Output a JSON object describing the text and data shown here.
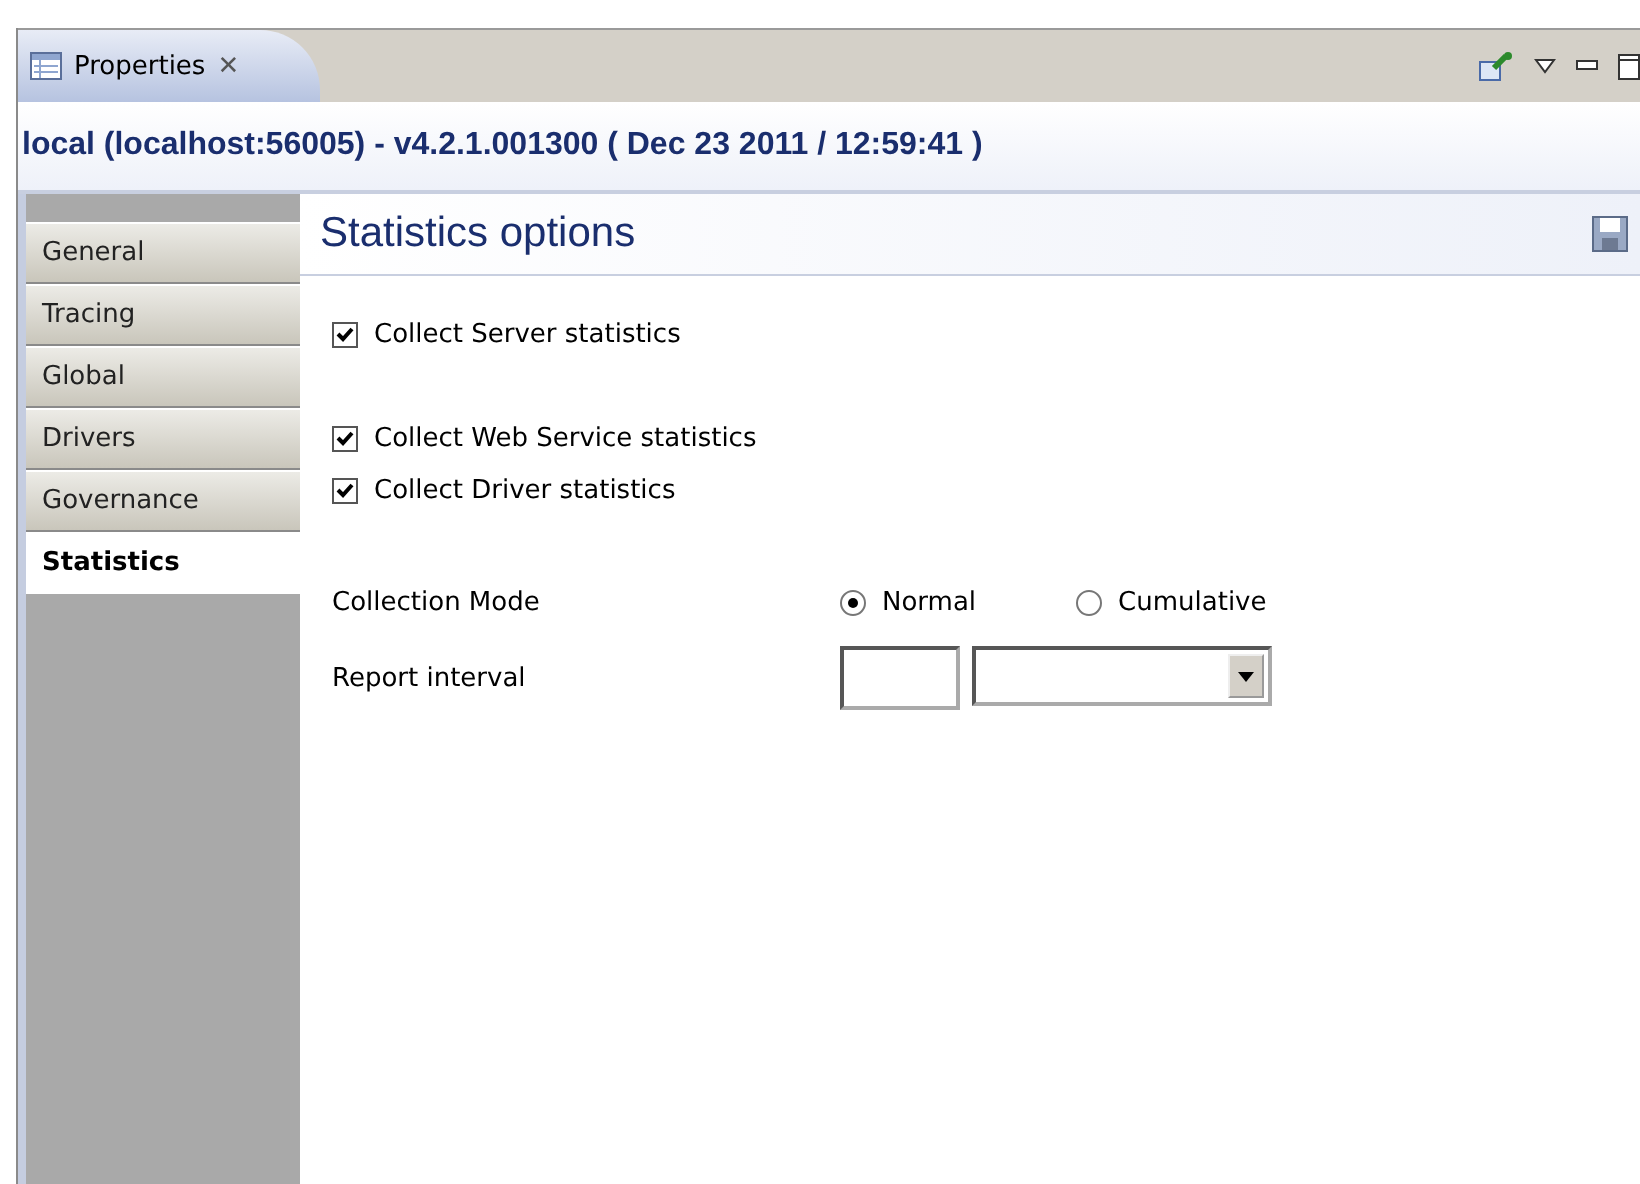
{
  "view_tab": {
    "label": "Properties",
    "close": "✕"
  },
  "header": {
    "title": "local (localhost:56005) - v4.2.1.001300 ( Dec 23 2011 / 12:59:41 )"
  },
  "sidebar": {
    "items": [
      {
        "label": "General",
        "selected": false
      },
      {
        "label": "Tracing",
        "selected": false
      },
      {
        "label": "Global",
        "selected": false
      },
      {
        "label": "Drivers",
        "selected": false
      },
      {
        "label": "Governance",
        "selected": false
      },
      {
        "label": "Statistics",
        "selected": true
      }
    ]
  },
  "section": {
    "title": "Statistics options"
  },
  "checkbox_groups": [
    [
      {
        "label": "Collect Server statistics",
        "checked": true
      }
    ],
    [
      {
        "label": "Collect Web Service statistics",
        "checked": true
      },
      {
        "label": "Collect Driver statistics",
        "checked": true
      }
    ]
  ],
  "collection_mode": {
    "label": "Collection Mode",
    "options": [
      {
        "label": "Normal",
        "selected": true
      },
      {
        "label": "Cumulative",
        "selected": false
      }
    ]
  },
  "report_interval": {
    "label": "Report interval"
  }
}
